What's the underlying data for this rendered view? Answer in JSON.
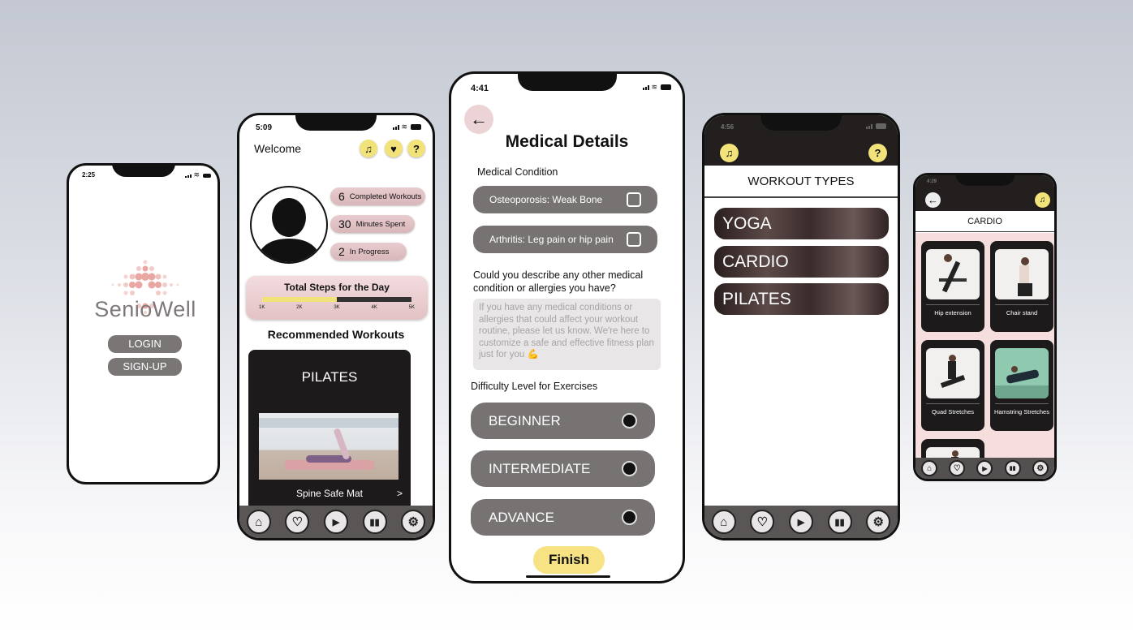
{
  "login_screen": {
    "time": "2:25",
    "brand": "SenioWell",
    "login_label": "LOGIN",
    "signup_label": "SIGN-UP"
  },
  "home_screen": {
    "time": "5:09",
    "welcome": "Welcome",
    "stats": [
      {
        "value": "6",
        "label": "Completed Workouts"
      },
      {
        "value": "30",
        "label": "Minutes Spent"
      },
      {
        "value": "2",
        "label": "In Progress"
      }
    ],
    "steps_title": "Total Steps for the Day",
    "steps_ticks": [
      "1K",
      "2K",
      "3K",
      "4K",
      "5K"
    ],
    "steps_progress": 0.5,
    "recommended_title": "Recommended Workouts",
    "workout_card_title": "PILATES",
    "workout_card_caption": "Spine Safe Mat",
    "workout_card_arrow": ">"
  },
  "medical_screen": {
    "time": "4:41",
    "back_label": "←",
    "title": "Medical Details",
    "condition_label": "Medical Condition",
    "conditions": [
      "Osteoporosis: Weak Bone",
      "Arthritis: Leg pain or hip pain"
    ],
    "describe_question": "Could you describe any other medical condition or allergies you have?",
    "describe_placeholder": "If you have any medical conditions or allergies that could affect your workout routine, please let us know. We're here to customize a safe and effective fitness plan just for you 💪",
    "difficulty_label": "Difficulty Level for Exercises",
    "difficulty_levels": [
      "BEGINNER",
      "INTERMEDIATE",
      "ADVANCE"
    ],
    "finish_label": "Finish"
  },
  "workout_types_screen": {
    "time": "4:56",
    "header": "WORKOUT TYPES",
    "types": [
      "YOGA",
      "CARDIO",
      "PILATES"
    ]
  },
  "cardio_screen": {
    "time": "4:29",
    "header": "CARDIO",
    "exercises": [
      "Hip extension",
      "Chair stand",
      "Quad Stretches",
      "Hamstring Stretches"
    ]
  },
  "icons": {
    "music": "music-icon",
    "heart": "heart-icon",
    "help": "help-icon",
    "home": "home-icon",
    "play": "play-icon",
    "stats": "chart-icon",
    "settings": "gear-icon"
  },
  "colors": {
    "accent_yellow": "#f2e27a",
    "pill_gray": "#777373",
    "card_dark": "#1c1a1a",
    "pink": "#f6dede",
    "nav_gray": "#5a5656"
  }
}
